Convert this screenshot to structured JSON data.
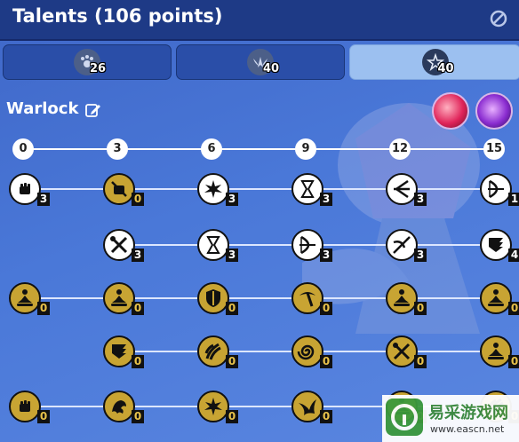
{
  "header": {
    "title": "Talents (106 points)"
  },
  "tabs": [
    {
      "icon": "paw-spec-icon",
      "count": "26"
    },
    {
      "icon": "wings-spec-icon",
      "count": "40"
    },
    {
      "icon": "star-spec-icon",
      "count": "40"
    }
  ],
  "active_tab": 2,
  "class_name": "Warlock",
  "tiers": [
    "0",
    "3",
    "6",
    "9",
    "12",
    "15"
  ],
  "rows": [
    [
      {
        "col": 0,
        "rank": "3",
        "state": "learned",
        "icon": "fist-icon"
      },
      {
        "col": 1,
        "rank": "0",
        "state": "unlocked",
        "icon": "crossed-fist-icon"
      },
      {
        "col": 2,
        "rank": "3",
        "state": "learned",
        "icon": "explosion-icon"
      },
      {
        "col": 3,
        "rank": "3",
        "state": "learned",
        "icon": "hourglass-icon"
      },
      {
        "col": 4,
        "rank": "3",
        "state": "learned",
        "icon": "arrow-spread-icon"
      },
      {
        "col": 5,
        "rank": "1",
        "state": "learned",
        "icon": "bow-icon"
      }
    ],
    [
      {
        "col": 1,
        "rank": "3",
        "state": "learned",
        "icon": "tools-icon"
      },
      {
        "col": 2,
        "rank": "3",
        "state": "learned",
        "icon": "hourglass-icon"
      },
      {
        "col": 3,
        "rank": "3",
        "state": "learned",
        "icon": "bow-icon"
      },
      {
        "col": 4,
        "rank": "3",
        "state": "learned",
        "icon": "crossbow-icon"
      },
      {
        "col": 5,
        "rank": "4",
        "state": "learned",
        "icon": "wing-banner-icon"
      }
    ],
    [
      {
        "col": 0,
        "rank": "0",
        "state": "unlocked",
        "icon": "meditate-icon"
      },
      {
        "col": 1,
        "rank": "0",
        "state": "unlocked",
        "icon": "meditate-icon"
      },
      {
        "col": 2,
        "rank": "0",
        "state": "unlocked",
        "icon": "shield-icon"
      },
      {
        "col": 3,
        "rank": "0",
        "state": "unlocked",
        "icon": "pickaxe-icon"
      },
      {
        "col": 4,
        "rank": "0",
        "state": "unlocked",
        "icon": "meditate-icon"
      },
      {
        "col": 5,
        "rank": "0",
        "state": "unlocked",
        "icon": "meditate-icon"
      }
    ],
    [
      {
        "col": 1,
        "rank": "0",
        "state": "unlocked",
        "icon": "wing-banner-icon"
      },
      {
        "col": 2,
        "rank": "0",
        "state": "unlocked",
        "icon": "claw-icon"
      },
      {
        "col": 3,
        "rank": "0",
        "state": "unlocked",
        "icon": "swirl-icon"
      },
      {
        "col": 4,
        "rank": "0",
        "state": "unlocked",
        "icon": "tools-icon"
      },
      {
        "col": 5,
        "rank": "0",
        "state": "unlocked",
        "icon": "meditate-icon"
      }
    ],
    [
      {
        "col": 0,
        "rank": "0",
        "state": "unlocked",
        "icon": "fist-icon"
      },
      {
        "col": 1,
        "rank": "0",
        "state": "unlocked",
        "icon": "beast-icon"
      },
      {
        "col": 2,
        "rank": "0",
        "state": "unlocked",
        "icon": "explosion-icon"
      },
      {
        "col": 3,
        "rank": "0",
        "state": "unlocked",
        "icon": "bird-icon"
      },
      {
        "col": 4,
        "rank": "0",
        "state": "unlocked",
        "icon": "meditate-icon"
      },
      {
        "col": 5,
        "rank": "0",
        "state": "unlocked",
        "icon": "claw-icon"
      }
    ]
  ],
  "watermark": {
    "name": "易采游戏网",
    "url": "www.eascn.net"
  },
  "colors": {
    "header": "#1e3a86",
    "tab": "#2a4ea8",
    "tab_active": "#9cc0f0",
    "node_unlocked": "#c8a433",
    "rank_unlocked": "#e8c24a"
  }
}
